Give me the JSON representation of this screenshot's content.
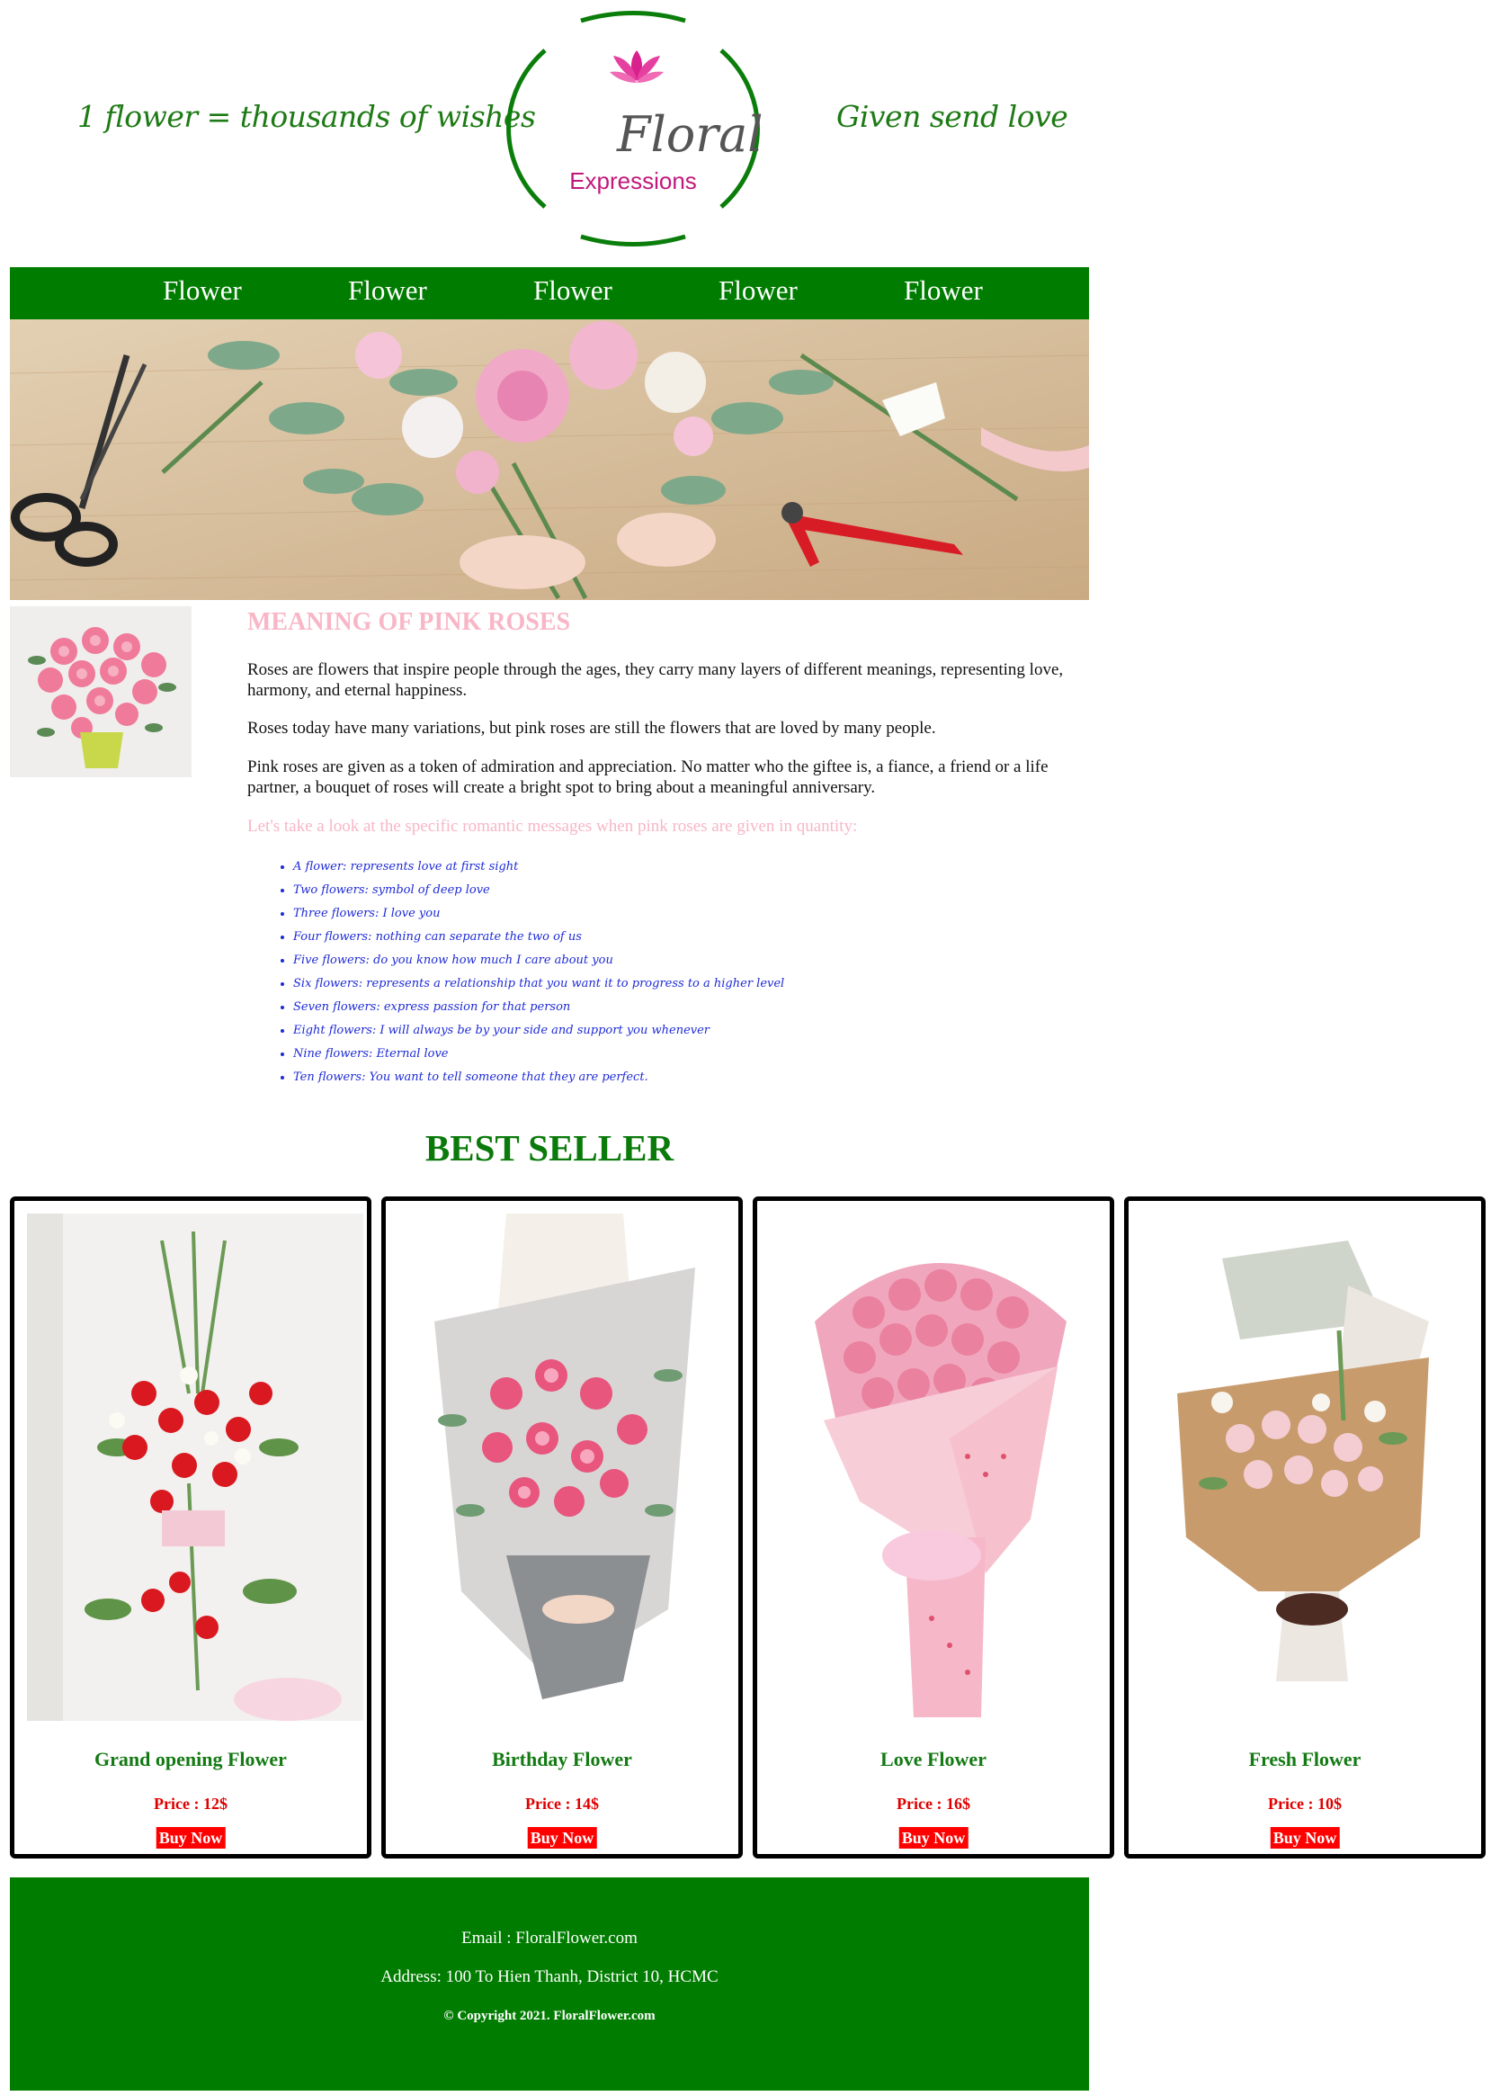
{
  "header": {
    "tagline_left": "1 flower = thousands of wishes",
    "tagline_right": "Given send love",
    "logo": {
      "brand_top": "Floral",
      "brand_bottom": "Expressions"
    }
  },
  "nav": {
    "items": [
      {
        "label": "Flower"
      },
      {
        "label": "Flower"
      },
      {
        "label": "Flower"
      },
      {
        "label": "Flower"
      },
      {
        "label": "Flower"
      }
    ]
  },
  "article": {
    "title": "MEANING OF PINK ROSES",
    "paragraphs": [
      "Roses are flowers that inspire people through the ages, they carry many layers of different meanings, representing love, harmony, and eternal happiness.",
      "Roses today have many variations, but pink roses are still the flowers that are loved by many people.",
      "Pink roses are given as a token of admiration and appreciation. No matter who the giftee is, a fiance, a friend or a life partner, a bouquet of roses will create a bright spot to bring about a meaningful anniversary."
    ],
    "lead": "Let's take a look at the specific romantic messages when pink roses are given in quantity:",
    "meanings": [
      "A flower: represents love at first sight",
      "Two flowers: symbol of deep love",
      "Three flowers: I love you",
      "Four flowers: nothing can separate the two of us",
      "Five flowers: do you know how much I care about you",
      "Six flowers: represents a relationship that you want it to progress to a higher level",
      "Seven flowers: express passion for that person",
      "Eight flowers: I will always be by your side and support you whenever",
      "Nine flowers: Eternal love",
      "Ten flowers: You want to tell someone that they are perfect."
    ]
  },
  "best_seller": {
    "title": "BEST SELLER",
    "products": [
      {
        "name": "Grand opening Flower",
        "price": "Price : 12$",
        "buy_label": "Buy Now"
      },
      {
        "name": "Birthday Flower",
        "price": "Price : 14$",
        "buy_label": "Buy Now"
      },
      {
        "name": "Love Flower",
        "price": "Price : 16$",
        "buy_label": "Buy Now"
      },
      {
        "name": "Fresh Flower",
        "price": "Price : 10$",
        "buy_label": "Buy Now"
      }
    ]
  },
  "footer": {
    "email": "Email : FloralFlower.com",
    "address": "Address: 100 To Hien Thanh, District 10, HCMC",
    "copyright": "© Copyright 2021. FloralFlower.com"
  },
  "colors": {
    "brand_green": "#007d00",
    "title_pink": "#f8b6c6",
    "list_blue": "#1e2bd6",
    "price_red": "#e00000",
    "buy_red": "#ff0000"
  }
}
